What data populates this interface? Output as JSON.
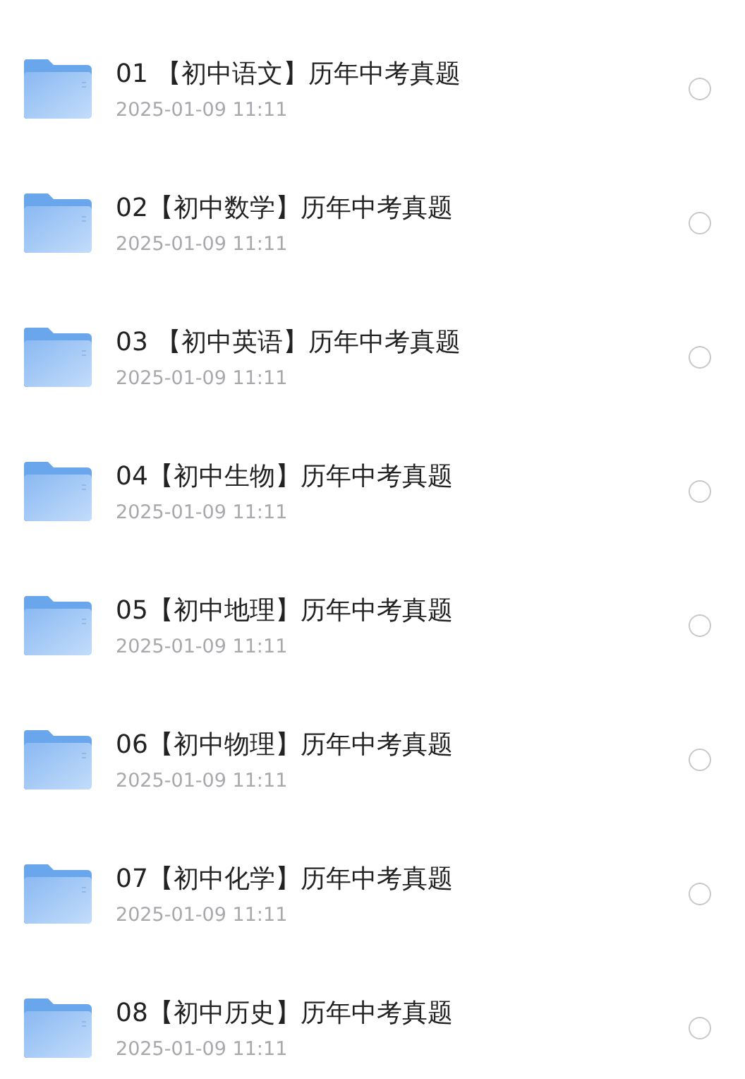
{
  "files": [
    {
      "name": "01 【初中语文】历年中考真题",
      "date": "2025-01-09 11:11",
      "selected": false
    },
    {
      "name": "02【初中数学】历年中考真题",
      "date": "2025-01-09 11:11",
      "selected": false
    },
    {
      "name": "03 【初中英语】历年中考真题",
      "date": "2025-01-09 11:11",
      "selected": false
    },
    {
      "name": "04【初中生物】历年中考真题",
      "date": "2025-01-09 11:11",
      "selected": false
    },
    {
      "name": "05【初中地理】历年中考真题",
      "date": "2025-01-09 11:11",
      "selected": false
    },
    {
      "name": "06【初中物理】历年中考真题",
      "date": "2025-01-09 11:11",
      "selected": false
    },
    {
      "name": "07【初中化学】历年中考真题",
      "date": "2025-01-09 11:11",
      "selected": false
    },
    {
      "name": "08【初中历史】历年中考真题",
      "date": "2025-01-09 11:11",
      "selected": false
    }
  ]
}
